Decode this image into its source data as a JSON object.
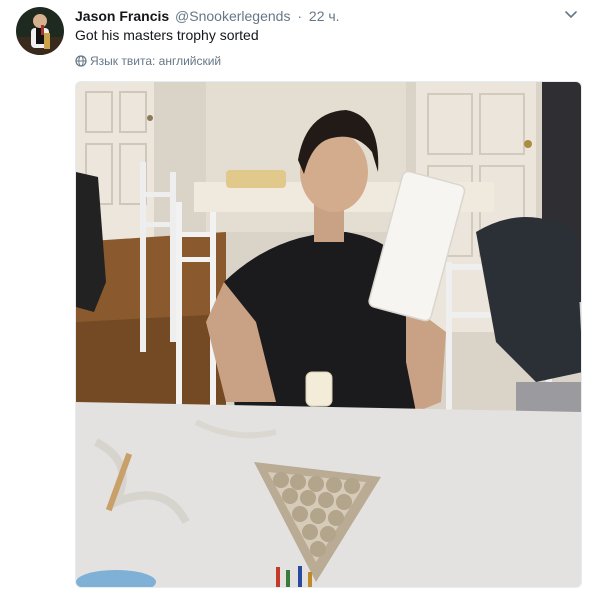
{
  "tweet": {
    "author_name": "Jason Francis",
    "author_handle": "@Snookerlegends",
    "separator": "·",
    "timestamp": "22 ч.",
    "text": "Got his masters trophy sorted",
    "language_note": "Язык твита: английский"
  },
  "icons": {
    "avatar": "avatar-photo",
    "menu": "chevron-down-icon",
    "language": "globe-icon"
  },
  "colors": {
    "primary_text": "#14171a",
    "secondary_text": "#657786",
    "border": "#e6ecf0"
  },
  "media": {
    "kind": "photo"
  }
}
